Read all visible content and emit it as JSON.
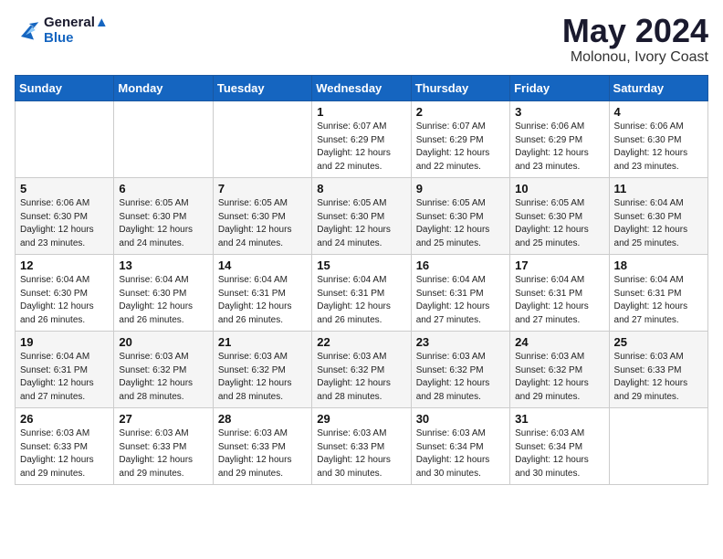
{
  "header": {
    "logo_line1": "General",
    "logo_line2": "Blue",
    "month": "May 2024",
    "location": "Molonou, Ivory Coast"
  },
  "days_of_week": [
    "Sunday",
    "Monday",
    "Tuesday",
    "Wednesday",
    "Thursday",
    "Friday",
    "Saturday"
  ],
  "weeks": [
    {
      "row": 1,
      "days": [
        {
          "num": "",
          "info": ""
        },
        {
          "num": "",
          "info": ""
        },
        {
          "num": "",
          "info": ""
        },
        {
          "num": "1",
          "info": "Sunrise: 6:07 AM\nSunset: 6:29 PM\nDaylight: 12 hours\nand 22 minutes."
        },
        {
          "num": "2",
          "info": "Sunrise: 6:07 AM\nSunset: 6:29 PM\nDaylight: 12 hours\nand 22 minutes."
        },
        {
          "num": "3",
          "info": "Sunrise: 6:06 AM\nSunset: 6:29 PM\nDaylight: 12 hours\nand 23 minutes."
        },
        {
          "num": "4",
          "info": "Sunrise: 6:06 AM\nSunset: 6:30 PM\nDaylight: 12 hours\nand 23 minutes."
        }
      ]
    },
    {
      "row": 2,
      "days": [
        {
          "num": "5",
          "info": "Sunrise: 6:06 AM\nSunset: 6:30 PM\nDaylight: 12 hours\nand 23 minutes."
        },
        {
          "num": "6",
          "info": "Sunrise: 6:05 AM\nSunset: 6:30 PM\nDaylight: 12 hours\nand 24 minutes."
        },
        {
          "num": "7",
          "info": "Sunrise: 6:05 AM\nSunset: 6:30 PM\nDaylight: 12 hours\nand 24 minutes."
        },
        {
          "num": "8",
          "info": "Sunrise: 6:05 AM\nSunset: 6:30 PM\nDaylight: 12 hours\nand 24 minutes."
        },
        {
          "num": "9",
          "info": "Sunrise: 6:05 AM\nSunset: 6:30 PM\nDaylight: 12 hours\nand 25 minutes."
        },
        {
          "num": "10",
          "info": "Sunrise: 6:05 AM\nSunset: 6:30 PM\nDaylight: 12 hours\nand 25 minutes."
        },
        {
          "num": "11",
          "info": "Sunrise: 6:04 AM\nSunset: 6:30 PM\nDaylight: 12 hours\nand 25 minutes."
        }
      ]
    },
    {
      "row": 3,
      "days": [
        {
          "num": "12",
          "info": "Sunrise: 6:04 AM\nSunset: 6:30 PM\nDaylight: 12 hours\nand 26 minutes."
        },
        {
          "num": "13",
          "info": "Sunrise: 6:04 AM\nSunset: 6:30 PM\nDaylight: 12 hours\nand 26 minutes."
        },
        {
          "num": "14",
          "info": "Sunrise: 6:04 AM\nSunset: 6:31 PM\nDaylight: 12 hours\nand 26 minutes."
        },
        {
          "num": "15",
          "info": "Sunrise: 6:04 AM\nSunset: 6:31 PM\nDaylight: 12 hours\nand 26 minutes."
        },
        {
          "num": "16",
          "info": "Sunrise: 6:04 AM\nSunset: 6:31 PM\nDaylight: 12 hours\nand 27 minutes."
        },
        {
          "num": "17",
          "info": "Sunrise: 6:04 AM\nSunset: 6:31 PM\nDaylight: 12 hours\nand 27 minutes."
        },
        {
          "num": "18",
          "info": "Sunrise: 6:04 AM\nSunset: 6:31 PM\nDaylight: 12 hours\nand 27 minutes."
        }
      ]
    },
    {
      "row": 4,
      "days": [
        {
          "num": "19",
          "info": "Sunrise: 6:04 AM\nSunset: 6:31 PM\nDaylight: 12 hours\nand 27 minutes."
        },
        {
          "num": "20",
          "info": "Sunrise: 6:03 AM\nSunset: 6:32 PM\nDaylight: 12 hours\nand 28 minutes."
        },
        {
          "num": "21",
          "info": "Sunrise: 6:03 AM\nSunset: 6:32 PM\nDaylight: 12 hours\nand 28 minutes."
        },
        {
          "num": "22",
          "info": "Sunrise: 6:03 AM\nSunset: 6:32 PM\nDaylight: 12 hours\nand 28 minutes."
        },
        {
          "num": "23",
          "info": "Sunrise: 6:03 AM\nSunset: 6:32 PM\nDaylight: 12 hours\nand 28 minutes."
        },
        {
          "num": "24",
          "info": "Sunrise: 6:03 AM\nSunset: 6:32 PM\nDaylight: 12 hours\nand 29 minutes."
        },
        {
          "num": "25",
          "info": "Sunrise: 6:03 AM\nSunset: 6:33 PM\nDaylight: 12 hours\nand 29 minutes."
        }
      ]
    },
    {
      "row": 5,
      "days": [
        {
          "num": "26",
          "info": "Sunrise: 6:03 AM\nSunset: 6:33 PM\nDaylight: 12 hours\nand 29 minutes."
        },
        {
          "num": "27",
          "info": "Sunrise: 6:03 AM\nSunset: 6:33 PM\nDaylight: 12 hours\nand 29 minutes."
        },
        {
          "num": "28",
          "info": "Sunrise: 6:03 AM\nSunset: 6:33 PM\nDaylight: 12 hours\nand 29 minutes."
        },
        {
          "num": "29",
          "info": "Sunrise: 6:03 AM\nSunset: 6:33 PM\nDaylight: 12 hours\nand 30 minutes."
        },
        {
          "num": "30",
          "info": "Sunrise: 6:03 AM\nSunset: 6:34 PM\nDaylight: 12 hours\nand 30 minutes."
        },
        {
          "num": "31",
          "info": "Sunrise: 6:03 AM\nSunset: 6:34 PM\nDaylight: 12 hours\nand 30 minutes."
        },
        {
          "num": "",
          "info": ""
        }
      ]
    }
  ]
}
